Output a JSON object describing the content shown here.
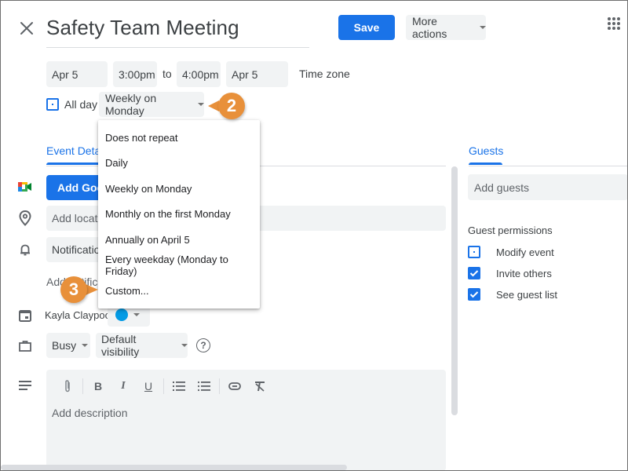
{
  "header": {
    "title": "Safety Team Meeting",
    "save_label": "Save",
    "more_actions_label": "More actions"
  },
  "datetime": {
    "start_date": "Apr 5",
    "start_time": "3:00pm",
    "to_label": "to",
    "end_time": "4:00pm",
    "end_date": "Apr 5",
    "time_zone_label": "Time zone",
    "all_day_label": "All day",
    "all_day_checked": false,
    "repeat_value": "Weekly on Monday"
  },
  "repeat_menu": {
    "items": [
      {
        "label": "Does not repeat"
      },
      {
        "label": "Daily"
      },
      {
        "label": "Weekly on Monday"
      },
      {
        "label": "Monthly on the first Monday"
      },
      {
        "label": "Annually on April 5"
      },
      {
        "label": "Every weekday (Monday to Friday)"
      },
      {
        "label": "Custom..."
      }
    ]
  },
  "callouts": {
    "step2": "2",
    "step3": "3",
    "color": "#e8903a"
  },
  "tabs": {
    "event_details": "Event Details",
    "guests": "Guests"
  },
  "details": {
    "meet_button": "Add Google Meet video conferencing",
    "location_placeholder": "Add location",
    "notification_label": "Notification",
    "add_notification": "Add notification",
    "calendar_owner": "Kayla Claypool",
    "calendar_color": "#039be5",
    "availability": "Busy",
    "visibility": "Default visibility",
    "help_glyph": "?",
    "description_placeholder": "Add description",
    "toolbar": [
      {
        "icon": "attachment-icon"
      },
      {
        "icon": "bold-icon",
        "glyph": "B"
      },
      {
        "icon": "italic-icon",
        "glyph": "I"
      },
      {
        "icon": "underline-icon",
        "glyph": "U"
      },
      {
        "icon": "numbered-list-icon"
      },
      {
        "icon": "bulleted-list-icon"
      },
      {
        "icon": "link-icon"
      },
      {
        "icon": "clear-formatting-icon"
      }
    ]
  },
  "guests": {
    "add_guests_placeholder": "Add guests",
    "permissions_title": "Guest permissions",
    "permissions": [
      {
        "label": "Modify event",
        "checked": false
      },
      {
        "label": "Invite others",
        "checked": true
      },
      {
        "label": "See guest list",
        "checked": true
      }
    ]
  },
  "colors": {
    "accent": "#1a73e8",
    "field_bg": "#f1f3f4",
    "text": "#3c4043"
  }
}
